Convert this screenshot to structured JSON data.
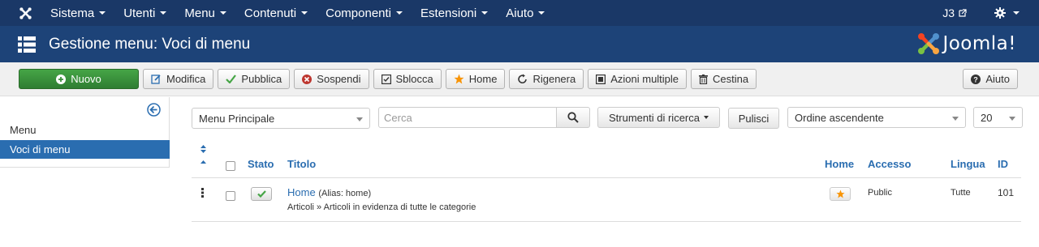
{
  "navbar": {
    "items": [
      {
        "label": "Sistema"
      },
      {
        "label": "Utenti"
      },
      {
        "label": "Menu"
      },
      {
        "label": "Contenuti"
      },
      {
        "label": "Componenti"
      },
      {
        "label": "Estensioni"
      },
      {
        "label": "Aiuto"
      }
    ],
    "site_label": "J3",
    "icons": {
      "logo": "joomla-icon",
      "external": "external-link-icon",
      "settings": "gear-icon"
    }
  },
  "header": {
    "title": "Gestione menu: Voci di menu",
    "brand": "Joomla!"
  },
  "toolbar": {
    "new": "Nuovo",
    "edit": "Modifica",
    "publish": "Pubblica",
    "unpublish": "Sospendi",
    "checkin": "Sblocca",
    "home": "Home",
    "rebuild": "Rigenera",
    "batch": "Azioni multiple",
    "trash": "Cestina",
    "help": "Aiuto"
  },
  "sidebar": {
    "items": [
      {
        "label": "Menu",
        "active": false
      },
      {
        "label": "Voci di menu",
        "active": true
      }
    ]
  },
  "filters": {
    "menu_select": "Menu Principale",
    "search_placeholder": "Cerca",
    "search_tools": "Strumenti di ricerca",
    "clear": "Pulisci",
    "ordering": "Ordine ascendente",
    "limit": "20"
  },
  "table": {
    "headers": {
      "status": "Stato",
      "title": "Titolo",
      "home": "Home",
      "access": "Accesso",
      "language": "Lingua",
      "id": "ID"
    },
    "rows": [
      {
        "title": "Home",
        "alias": "(Alias: home)",
        "path": "Articoli » Articoli in evidenza di tutte le categorie",
        "access": "Public",
        "language": "Tutte",
        "id": "101"
      }
    ]
  },
  "colors": {
    "navbar": "#1a3867",
    "header": "#1d4378",
    "primary": "#2a6db0",
    "success": "#46a546",
    "danger": "#bd362f",
    "warning": "#f89406"
  }
}
